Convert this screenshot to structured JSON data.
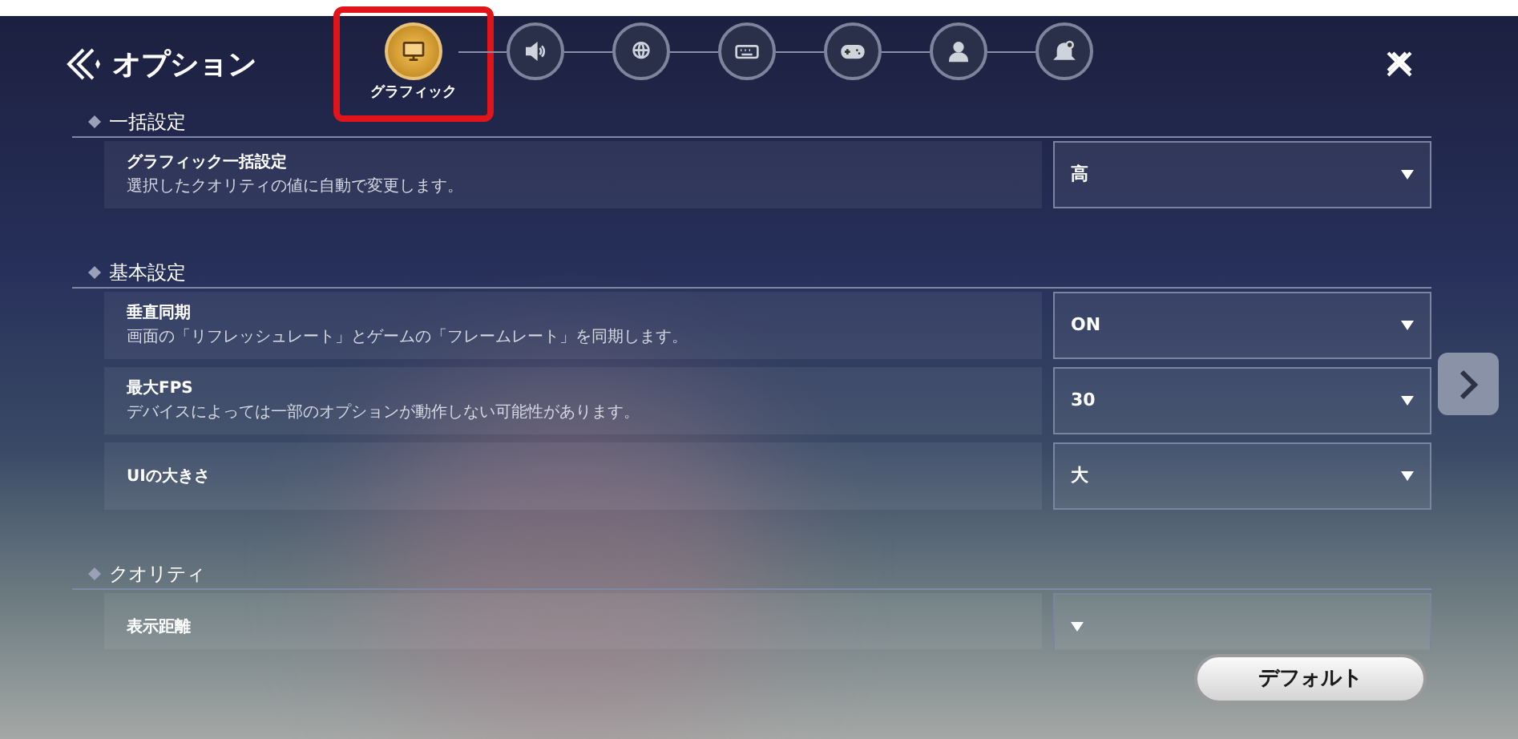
{
  "header": {
    "title": "オプション"
  },
  "tabs": [
    {
      "label": "グラフィック",
      "selected": true
    },
    {
      "selected": false
    },
    {
      "selected": false
    },
    {
      "selected": false
    },
    {
      "selected": false
    },
    {
      "selected": false
    },
    {
      "selected": false
    }
  ],
  "sections": [
    {
      "title": "一括設定",
      "rows": [
        {
          "title": "グラフィック一括設定",
          "description": "選択したクオリティの値に自動で変更します。",
          "value": "高"
        }
      ]
    },
    {
      "title": "基本設定",
      "rows": [
        {
          "title": "垂直同期",
          "description": "画面の「リフレッシュレート」とゲームの「フレームレート」を同期します。",
          "value": "ON"
        },
        {
          "title": "最大FPS",
          "description": "デバイスによっては一部のオプションが動作しない可能性があります。",
          "value": "30"
        },
        {
          "title": "UIの大きさ",
          "value": "大"
        }
      ]
    },
    {
      "title": "クオリティ",
      "rows": [
        {
          "title": "表示距離"
        }
      ]
    }
  ],
  "default_button": "デフォルト"
}
